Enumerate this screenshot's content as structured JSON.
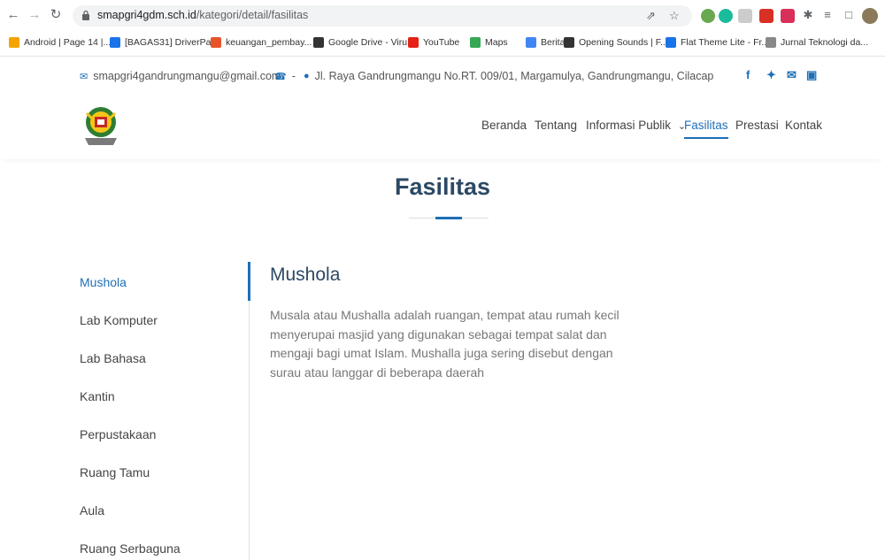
{
  "browser": {
    "url_domain": "smapgri4gdm.sch.id",
    "url_path": "/kategori/detail/fasilitas",
    "bookmarks": [
      {
        "label": "Android | Page 14 |...",
        "icon": "android-icon",
        "color": "#f4a300"
      },
      {
        "label": "[BAGAS31] DriverPa...",
        "icon": "document-icon",
        "color": "#1a73e8"
      },
      {
        "label": "keuangan_pembay...",
        "icon": "cp-icon",
        "color": "#e8542a"
      },
      {
        "label": "Google Drive - Viru...",
        "icon": "globe-icon",
        "color": "#333333"
      },
      {
        "label": "YouTube",
        "icon": "youtube-icon",
        "color": "#e62117"
      },
      {
        "label": "Maps",
        "icon": "maps-icon",
        "color": "#34a853"
      },
      {
        "label": "Berita",
        "icon": "news-icon",
        "color": "#4285f4"
      },
      {
        "label": "Opening Sounds | F...",
        "icon": "sound-icon",
        "color": "#333333"
      },
      {
        "label": "Flat Theme Lite - Fr...",
        "icon": "flat-theme-icon",
        "color": "#1a73e8"
      },
      {
        "label": "Jurnal Teknologi da...",
        "icon": "journal-icon",
        "color": "#888888"
      }
    ]
  },
  "topbar": {
    "email": "smapgri4gandrungmangu@gmail.com",
    "phone": "-",
    "address": "Jl. Raya Gandrungmangu No.RT. 009/01, Margamulya, Gandrungmangu, Cilacap",
    "social": [
      "facebook-icon",
      "twitter-icon",
      "email-icon",
      "instagram-icon"
    ],
    "social_glyphs": [
      "f",
      "✦",
      "✉",
      "▣"
    ]
  },
  "nav": {
    "items": [
      "Beranda",
      "Tentang",
      "Informasi Publik",
      "Fasilitas",
      "Prestasi",
      "Kontak"
    ],
    "dropdown_glyph": "⌄"
  },
  "page": {
    "title": "Fasilitas"
  },
  "sidebar": {
    "items": [
      "Mushola",
      "Lab Komputer",
      "Lab Bahasa",
      "Kantin",
      "Perpustakaan",
      "Ruang Tamu",
      "Aula",
      "Ruang Serbaguna"
    ],
    "active_index": 0
  },
  "content": {
    "title": "Mushola",
    "body": "Musala atau Mushalla adalah ruangan, tempat atau rumah kecil menyerupai masjid yang digunakan sebagai tempat salat dan mengaji bagi umat Islam. Mushalla juga sering disebut dengan surau atau langgar di beberapa daerah"
  },
  "colors": {
    "accent": "#1d6fb8",
    "heading": "#2c4964"
  }
}
